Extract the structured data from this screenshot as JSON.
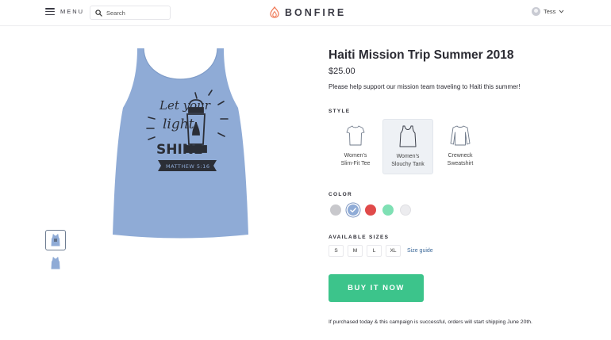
{
  "header": {
    "menu_label": "MENU",
    "search_placeholder": "Search",
    "brand": "BONFIRE",
    "user_name": "Tess",
    "brand_color": "#f07c5a"
  },
  "gallery": {
    "thumbnails": [
      {
        "label": "thumbnail-front",
        "selected": true
      },
      {
        "label": "thumbnail-back",
        "selected": false
      }
    ],
    "product_color": "#8fabd6",
    "print_text": [
      "Let your",
      "light",
      "SHINE",
      "MATTHEW 5:16"
    ]
  },
  "product": {
    "title": "Haiti Mission Trip Summer 2018",
    "price": "$25.00",
    "description": "Please help support our mission team traveling to Haiti this summer!"
  },
  "style_section": {
    "label": "STYLE",
    "options": [
      {
        "label": "Women's\nSlim-Fit Tee",
        "icon": "tee-icon",
        "selected": false
      },
      {
        "label": "Women's\nSlouchy Tank",
        "icon": "tank-icon",
        "selected": true
      },
      {
        "label": "Crewneck\nSweatshirt",
        "icon": "sweatshirt-icon",
        "selected": false
      }
    ]
  },
  "color_section": {
    "label": "COLOR",
    "options": [
      {
        "name": "grey",
        "hex": "#c8c8cc",
        "selected": false
      },
      {
        "name": "blue",
        "hex": "#8fabd6",
        "selected": true
      },
      {
        "name": "red",
        "hex": "#e04a4a",
        "selected": false
      },
      {
        "name": "mint",
        "hex": "#7fe0b4",
        "selected": false
      },
      {
        "name": "white",
        "hex": "#ececef",
        "selected": false
      }
    ]
  },
  "size_section": {
    "label": "AVAILABLE SIZES",
    "sizes": [
      "S",
      "M",
      "L",
      "XL"
    ],
    "guide_label": "Size guide"
  },
  "buy_button": {
    "label": "BUY IT NOW",
    "color": "#3cc48b"
  },
  "footnote": "If purchased today & this campaign is successful, orders will start shipping June 20th."
}
